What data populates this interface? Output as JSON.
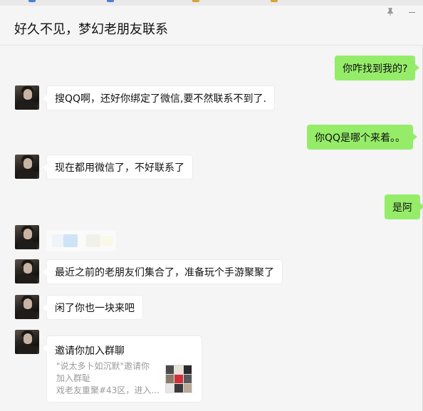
{
  "window": {
    "title": "好久不见，梦幻老朋友联系"
  },
  "messages": [
    {
      "side": "out",
      "text": "你咋找到我的?"
    },
    {
      "side": "in",
      "text": "搜QQ啊，还好你绑定了微信,要不然联系不到了."
    },
    {
      "side": "out",
      "text": "你QQ是哪个来着。。"
    },
    {
      "side": "in",
      "text": "现在都用微信了，不好联系了"
    },
    {
      "side": "out",
      "text": "是阿"
    },
    {
      "side": "in",
      "text": ""
    },
    {
      "side": "in",
      "text": "最近之前的老朋友们集合了，准备玩个手游聚聚了"
    },
    {
      "side": "in",
      "text": "闲了你也一块来吧"
    }
  ],
  "group_invite": {
    "title": "邀请你加入群聊",
    "desc_line1": "\"说太多卜如沉默\"邀请你",
    "desc_line2": "加入群耻",
    "desc_line3": "戏老友重聚#43区，进入..."
  },
  "icons": {
    "pin": "pin-icon",
    "minimize": "minimize-icon"
  },
  "colors": {
    "outgoing_bubble": "#95ec69",
    "incoming_bubble": "#ffffff",
    "background": "#f5f5f5"
  }
}
